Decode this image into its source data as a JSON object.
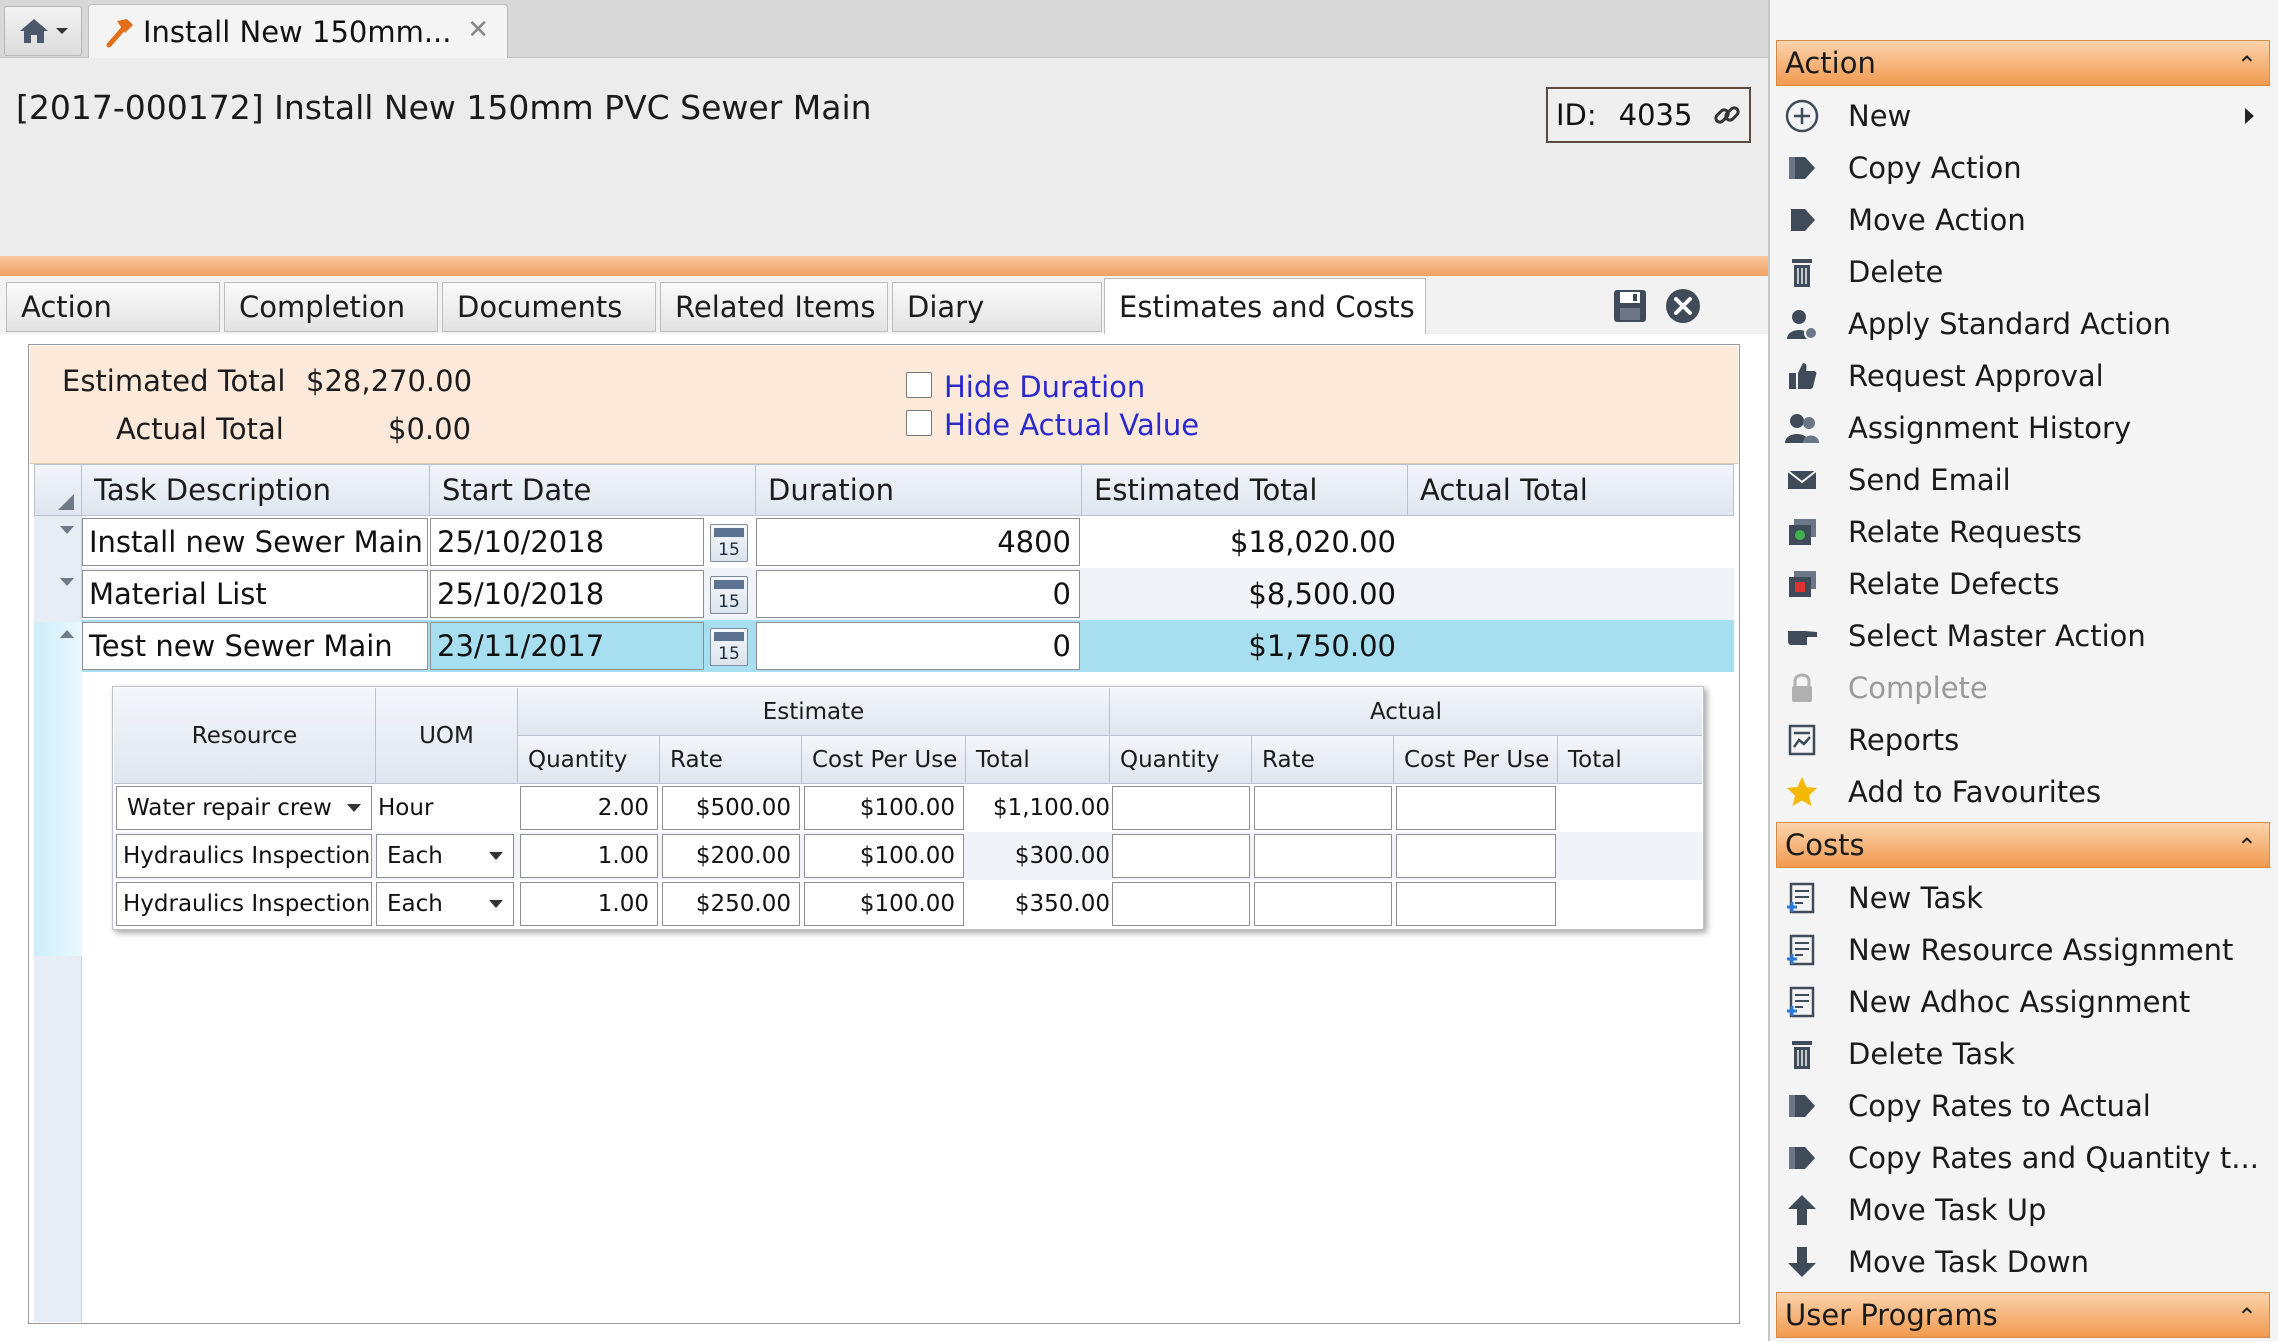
{
  "tab": {
    "title": "Install New 150mm..."
  },
  "header": {
    "title": "[2017-000172] Install New 150mm PVC Sewer Main",
    "id_label": "ID:",
    "id_value": "4035"
  },
  "section_tabs": [
    "Action",
    "Completion",
    "Documents",
    "Related Items",
    "Diary",
    "Estimates and Costs"
  ],
  "summary": {
    "estimated_label": "Estimated Total",
    "estimated_value": "$28,270.00",
    "actual_label": "Actual Total",
    "actual_value": "$0.00",
    "hide_duration": "Hide Duration",
    "hide_actual": "Hide Actual Value"
  },
  "task_grid": {
    "columns": [
      "Task Description",
      "Start Date",
      "Duration",
      "Estimated Total",
      "Actual Total"
    ],
    "rows": [
      {
        "description": "Install new Sewer Main",
        "start": "25/10/2018",
        "cal": "15",
        "duration": "4800",
        "estimated": "$18,020.00",
        "actual": ""
      },
      {
        "description": "Material List",
        "start": "25/10/2018",
        "cal": "15",
        "duration": "0",
        "estimated": "$8,500.00",
        "actual": ""
      },
      {
        "description": "Test new Sewer Main",
        "start": "23/11/2017",
        "cal": "15",
        "duration": "0",
        "estimated": "$1,750.00",
        "actual": ""
      }
    ]
  },
  "resource_grid": {
    "group_estimate": "Estimate",
    "group_actual": "Actual",
    "columns": {
      "resource": "Resource",
      "uom": "UOM",
      "quantity": "Quantity",
      "rate": "Rate",
      "cost_per_use": "Cost Per Use",
      "total": "Total"
    },
    "rows": [
      {
        "resource": "Water repair crew",
        "uom": "Hour",
        "qty": "2.00",
        "rate": "$500.00",
        "cpu": "$100.00",
        "total": "$1,100.00"
      },
      {
        "resource": "Hydraulics Inspection",
        "uom": "Each",
        "qty": "1.00",
        "rate": "$200.00",
        "cpu": "$100.00",
        "total": "$300.00"
      },
      {
        "resource": "Hydraulics Inspection",
        "uom": "Each",
        "qty": "1.00",
        "rate": "$250.00",
        "cpu": "$100.00",
        "total": "$350.00"
      }
    ]
  },
  "panel": {
    "action_header": "Action",
    "action_items": [
      {
        "label": "New",
        "icon": "plus-circle-icon"
      },
      {
        "label": "Copy Action",
        "icon": "copy-action-icon"
      },
      {
        "label": "Move Action",
        "icon": "move-action-icon"
      },
      {
        "label": "Delete",
        "icon": "trash-icon"
      },
      {
        "label": "Apply Standard Action",
        "icon": "user-gear-icon"
      },
      {
        "label": "Request Approval",
        "icon": "thumbs-up-icon"
      },
      {
        "label": "Assignment History",
        "icon": "users-icon"
      },
      {
        "label": "Send Email",
        "icon": "envelope-icon"
      },
      {
        "label": "Relate Requests",
        "icon": "relate-requests-icon"
      },
      {
        "label": "Relate Defects",
        "icon": "relate-defects-icon"
      },
      {
        "label": "Select Master Action",
        "icon": "pointing-hand-icon"
      },
      {
        "label": "Complete",
        "icon": "lock-icon"
      },
      {
        "label": "Reports",
        "icon": "report-icon"
      },
      {
        "label": "Add to Favourites",
        "icon": "star-icon"
      }
    ],
    "costs_header": "Costs",
    "costs_items": [
      {
        "label": "New Task",
        "icon": "new-task-icon"
      },
      {
        "label": "New Resource Assignment",
        "icon": "new-resource-icon"
      },
      {
        "label": "New Adhoc Assignment",
        "icon": "new-adhoc-icon"
      },
      {
        "label": "Delete Task",
        "icon": "trash-icon"
      },
      {
        "label": "Copy Rates to Actual",
        "icon": "copy-rates-icon"
      },
      {
        "label": "Copy Rates and Quantity t...",
        "icon": "copy-rates-qty-icon"
      },
      {
        "label": "Move Task Up",
        "icon": "arrow-up-icon"
      },
      {
        "label": "Move Task Down",
        "icon": "arrow-down-icon"
      }
    ],
    "user_programs_header": "User Programs"
  },
  "colors": {
    "accent_orange": "#f29a4f",
    "selected_row": "#a8dff0",
    "summary_bg": "#fde9d9",
    "link_blue": "#2a2acc"
  }
}
